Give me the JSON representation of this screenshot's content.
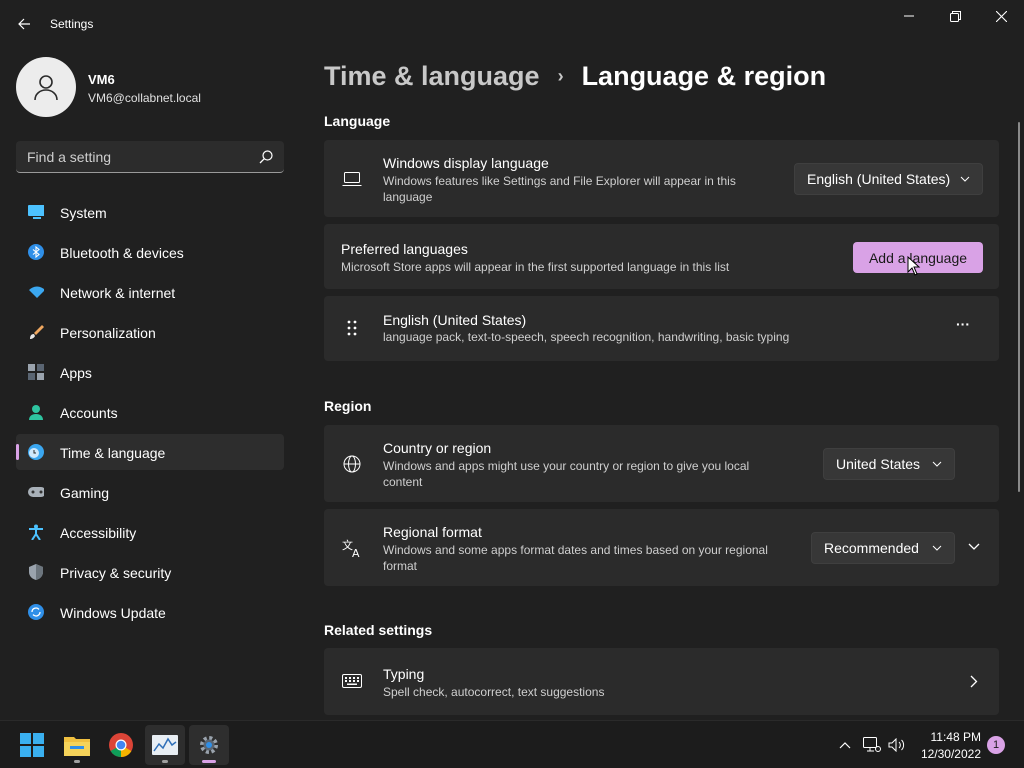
{
  "window": {
    "title": "Settings"
  },
  "profile": {
    "name": "VM6",
    "email": "VM6@collabnet.local"
  },
  "search": {
    "placeholder": "Find a setting"
  },
  "sidebar": {
    "items": [
      {
        "label": "System",
        "icon": "system-icon"
      },
      {
        "label": "Bluetooth & devices",
        "icon": "bluetooth-icon"
      },
      {
        "label": "Network & internet",
        "icon": "wifi-icon"
      },
      {
        "label": "Personalization",
        "icon": "brush-icon"
      },
      {
        "label": "Apps",
        "icon": "apps-icon"
      },
      {
        "label": "Accounts",
        "icon": "accounts-icon"
      },
      {
        "label": "Time & language",
        "icon": "time-language-icon",
        "active": true
      },
      {
        "label": "Gaming",
        "icon": "gamepad-icon"
      },
      {
        "label": "Accessibility",
        "icon": "accessibility-icon"
      },
      {
        "label": "Privacy & security",
        "icon": "shield-icon"
      },
      {
        "label": "Windows Update",
        "icon": "update-icon"
      }
    ]
  },
  "breadcrumb": {
    "parent": "Time & language",
    "separator": "›",
    "current": "Language & region"
  },
  "language": {
    "title": "Language",
    "display_language": {
      "title": "Windows display language",
      "desc_line1": "Windows features like Settings and File Explorer will appear in this",
      "desc_line2": "language",
      "value": "English (United States)"
    },
    "preferred": {
      "title": "Preferred languages",
      "desc": "Microsoft Store apps will appear in the first supported language in this list",
      "button": "Add a language"
    },
    "installed": {
      "title": "English (United States)",
      "desc": "language pack, text-to-speech, speech recognition, handwriting, basic typing",
      "more": "···"
    }
  },
  "region": {
    "title": "Region",
    "country": {
      "title": "Country or region",
      "desc_line1": "Windows and apps might use your country or region to give you local",
      "desc_line2": "content",
      "value": "United States"
    },
    "format": {
      "title": "Regional format",
      "desc_line1": "Windows and some apps format dates and times based on your regional",
      "desc_line2": "format",
      "value": "Recommended"
    }
  },
  "related": {
    "title": "Related settings",
    "typing": {
      "title": "Typing",
      "desc": "Spell check, autocorrect, text suggestions"
    }
  },
  "taskbar": {
    "time": "11:48 PM",
    "date": "12/30/2022",
    "notifications": "1"
  },
  "colors": {
    "accent": "#d9a2e6",
    "background": "#202020",
    "card": "#2b2b2b"
  }
}
